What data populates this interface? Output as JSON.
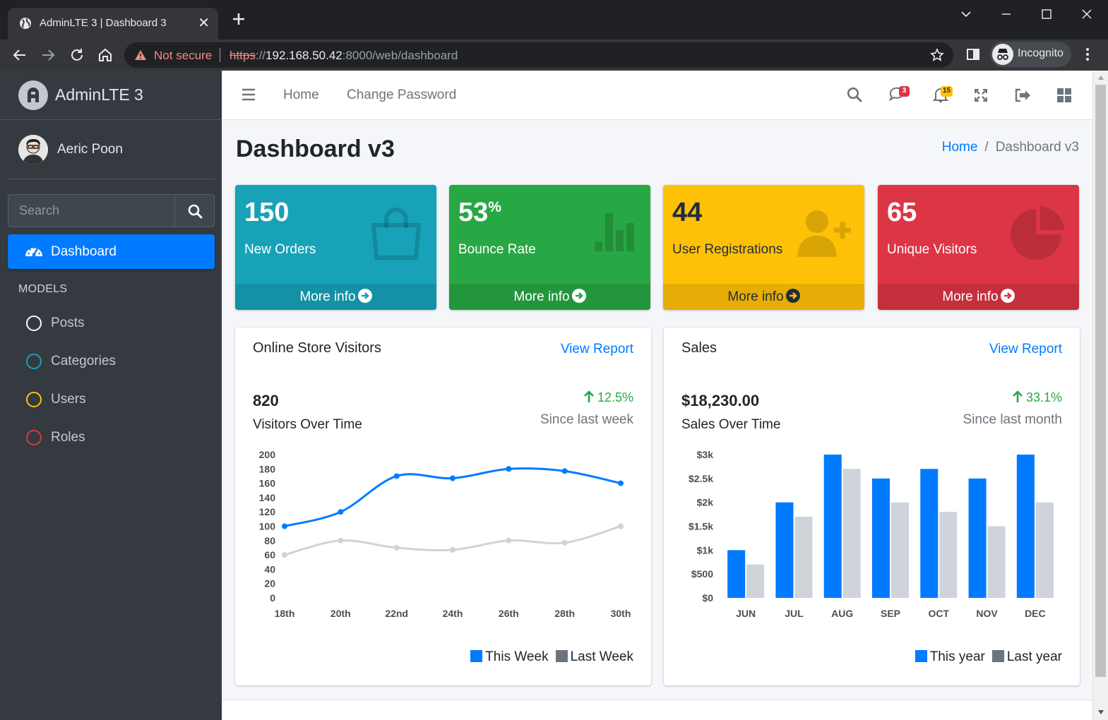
{
  "browser": {
    "tab_title": "AdminLTE 3 | Dashboard 3",
    "security_label": "Not secure",
    "url_scheme": "https",
    "url_sep": "://",
    "url_host": "192.168.50.42",
    "url_rest": ":8000/web/dashboard",
    "profile_label": "Incognito"
  },
  "sidebar": {
    "brand": "AdminLTE 3",
    "user_name": "Aeric Poon",
    "search_placeholder": "Search",
    "active_item": "Dashboard",
    "section_header": "MODELS",
    "items": [
      {
        "label": "Posts",
        "color": "#f8f9fa"
      },
      {
        "label": "Categories",
        "color": "#17a2b8"
      },
      {
        "label": "Users",
        "color": "#ffc107"
      },
      {
        "label": "Roles",
        "color": "#dc3545"
      }
    ]
  },
  "topnav": {
    "home": "Home",
    "change_password": "Change Password",
    "messages_badge": "3",
    "notifications_badge": "15"
  },
  "page": {
    "title": "Dashboard v3",
    "breadcrumb_home": "Home",
    "breadcrumb_sep": "/",
    "breadcrumb_current": "Dashboard v3"
  },
  "stats": [
    {
      "value": "150",
      "suffix": "",
      "label": "New Orders",
      "more": "More info",
      "color": "#17a2b8",
      "icon": "shopping-bag-icon"
    },
    {
      "value": "53",
      "suffix": "%",
      "label": "Bounce Rate",
      "more": "More info",
      "color": "#28a745",
      "icon": "bar-chart-icon"
    },
    {
      "value": "44",
      "suffix": "",
      "label": "User Registrations",
      "more": "More info",
      "color": "#ffc107",
      "icon": "user-plus-icon"
    },
    {
      "value": "65",
      "suffix": "",
      "label": "Unique Visitors",
      "more": "More info",
      "color": "#dc3545",
      "icon": "pie-chart-icon"
    }
  ],
  "visitors_card": {
    "title": "Online Store Visitors",
    "link": "View Report",
    "value": "820",
    "subtitle": "Visitors Over Time",
    "change": "12.5%",
    "since": "Since last week",
    "legend": [
      "This Week",
      "Last Week"
    ]
  },
  "sales_card": {
    "title": "Sales",
    "link": "View Report",
    "value": "$18,230.00",
    "subtitle": "Sales Over Time",
    "change": "33.1%",
    "since": "Since last month",
    "legend": [
      "This year",
      "Last year"
    ]
  },
  "chart_data": [
    {
      "type": "line",
      "x": [
        "18th",
        "20th",
        "22nd",
        "24th",
        "26th",
        "28th",
        "30th"
      ],
      "series": [
        {
          "name": "This Week",
          "color": "#007bff",
          "values": [
            100,
            120,
            170,
            167,
            180,
            177,
            160
          ]
        },
        {
          "name": "Last Week",
          "color": "#ced4da",
          "values": [
            60,
            80,
            70,
            67,
            80,
            77,
            100
          ]
        }
      ],
      "y_ticks": [
        "0",
        "20",
        "40",
        "60",
        "80",
        "100",
        "120",
        "140",
        "160",
        "180",
        "200"
      ],
      "ylim": [
        0,
        200
      ],
      "grid": false
    },
    {
      "type": "bar",
      "categories": [
        "JUN",
        "JUL",
        "AUG",
        "SEP",
        "OCT",
        "NOV",
        "DEC"
      ],
      "series": [
        {
          "name": "This year",
          "color": "#007bff",
          "values": [
            1000,
            2000,
            3000,
            2500,
            2700,
            2500,
            3000
          ]
        },
        {
          "name": "Last year",
          "color": "#ced4da",
          "values": [
            700,
            1700,
            2700,
            2000,
            1800,
            1500,
            2000
          ]
        }
      ],
      "y_ticks": [
        "$0",
        "$500",
        "$1k",
        "$1.5k",
        "$2k",
        "$2.5k",
        "$3k"
      ],
      "ylim": [
        0,
        3000
      ],
      "grid": false
    }
  ]
}
